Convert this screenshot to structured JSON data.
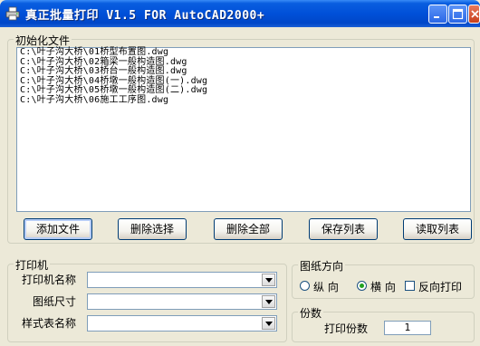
{
  "window": {
    "title": "真正批量打印 V1.5 FOR AutoCAD2000+"
  },
  "files_group": {
    "label": "初始化文件",
    "items": [
      "C:\\叶子沟大桥\\01桥型布置图.dwg",
      "C:\\叶子沟大桥\\02箱梁一般构造图.dwg",
      "C:\\叶子沟大桥\\03桥台一般构造图.dwg",
      "C:\\叶子沟大桥\\04桥墩一般构造图(一).dwg",
      "C:\\叶子沟大桥\\05桥墩一般构造图(二).dwg",
      "C:\\叶子沟大桥\\06施工工序图.dwg"
    ]
  },
  "buttons": {
    "add_file": "添加文件",
    "delete_selected": "删除选择",
    "delete_all": "删除全部",
    "save_list": "保存列表",
    "read_list": "读取列表"
  },
  "printer_group": {
    "label": "打印机",
    "printer_name_label": "打印机名称",
    "paper_size_label": "图纸尺寸",
    "style_table_label": "样式表名称",
    "printer_name_value": "",
    "paper_size_value": "",
    "style_table_value": ""
  },
  "orientation_group": {
    "label": "图纸方向",
    "portrait_label": "纵 向",
    "landscape_label": "横 向",
    "reverse_label": "反向打印",
    "selected": "landscape",
    "reverse_checked": false
  },
  "copies_group": {
    "label": "份数",
    "copies_label": "打印份数",
    "copies_value": "1"
  }
}
